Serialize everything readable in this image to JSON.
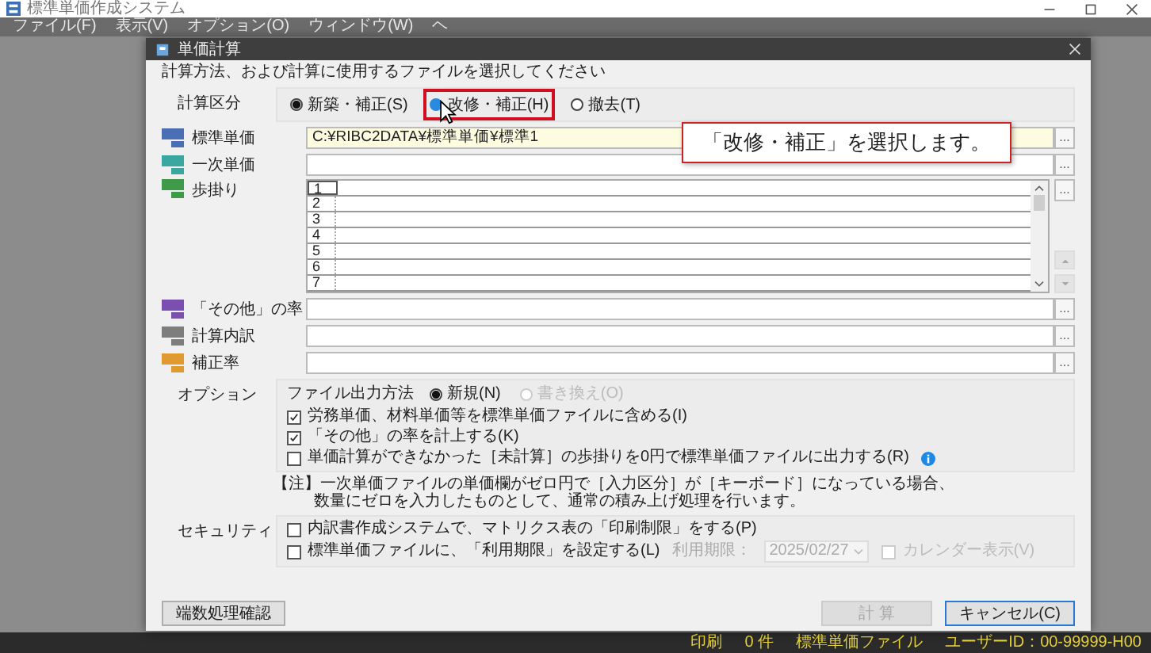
{
  "app": {
    "title": "標準単価作成システム",
    "menu": [
      "ファイル(F)",
      "表示(V)",
      "オプション(O)",
      "ウィンドウ(W)",
      "ヘ"
    ]
  },
  "dialog": {
    "title": "単価計算",
    "instruction": "計算方法、および計算に使用するファイルを選択してください",
    "calc_type": {
      "label": "計算区分",
      "options": [
        {
          "label": "新築・補正(S)",
          "selected": true,
          "pressed": false
        },
        {
          "label": "改修・補正(H)",
          "selected": false,
          "pressed": true
        },
        {
          "label": "撤去(T)",
          "selected": false,
          "pressed": false
        }
      ]
    },
    "callout": "「改修・補正」を選択します。",
    "files": [
      {
        "kind": "field",
        "label": "標準単価",
        "color": "#4a6fb5",
        "value": "C:¥RIBC2DATA¥標準単価¥標準1",
        "highlight": true,
        "browse": "..."
      },
      {
        "kind": "field",
        "label": "一次単価",
        "color": "#3aa8a0",
        "highlight": false,
        "browse": "..."
      },
      {
        "kind": "list",
        "label": "歩掛り",
        "color": "#3f9a4a",
        "rows": [
          "1",
          "2",
          "3",
          "4",
          "5",
          "6",
          "7"
        ],
        "browse": "..."
      },
      {
        "kind": "field",
        "label": "「その他」の率",
        "color": "#7a4fb0",
        "highlight": false,
        "browse": "..."
      },
      {
        "kind": "field",
        "label": "計算内訳",
        "color": "#7d7d7d",
        "highlight": false,
        "browse": "..."
      },
      {
        "kind": "field",
        "label": "補正率",
        "color": "#e09a30",
        "highlight": false,
        "browse": "..."
      }
    ],
    "options": {
      "label": "オプション",
      "output_label": "ファイル出力方法",
      "output": [
        {
          "label": "新規(N)",
          "selected": true,
          "disabled": false
        },
        {
          "label": "書き換え(O)",
          "selected": false,
          "disabled": true
        }
      ],
      "checks": [
        {
          "label": "労務単価、材料単価等を標準単価ファイルに含める(I)",
          "checked": true,
          "info": false
        },
        {
          "label": "「その他」の率を計上する(K)",
          "checked": true,
          "info": false
        },
        {
          "label": "単価計算ができなかった［未計算］の歩掛りを0円で標準単価ファイルに出力する(R)",
          "checked": false,
          "info": true
        }
      ]
    },
    "note": [
      "【注】一次単価ファイルの単価欄がゼロ円で［入力区分］が［キーボード］になっている場合、",
      "数量にゼロを入力したものとして、通常の積み上げ処理を行います。"
    ],
    "security": {
      "label": "セキュリティ",
      "checks": [
        {
          "label": "内訳書作成システムで、マトリクス表の「印刷制限」をする(P)",
          "checked": false
        },
        {
          "label": "標準単価ファイルに、「利用期限」を設定する(L)",
          "checked": false
        }
      ],
      "expiry_label": "利用期限：",
      "expiry_date": "2025/02/27",
      "calendar": {
        "label": "カレンダー表示(V)",
        "checked": false
      }
    },
    "buttons": [
      {
        "kind": "left",
        "label": "端数処理確認",
        "disabled": false
      },
      {
        "kind": "right",
        "label": "計 算",
        "disabled": true
      },
      {
        "kind": "right",
        "label": "キャンセル(C)",
        "disabled": false
      }
    ]
  },
  "status_bar": [
    "印刷",
    "0 件",
    "標準単価ファイル",
    "ユーザーID：00-99999-H00"
  ]
}
